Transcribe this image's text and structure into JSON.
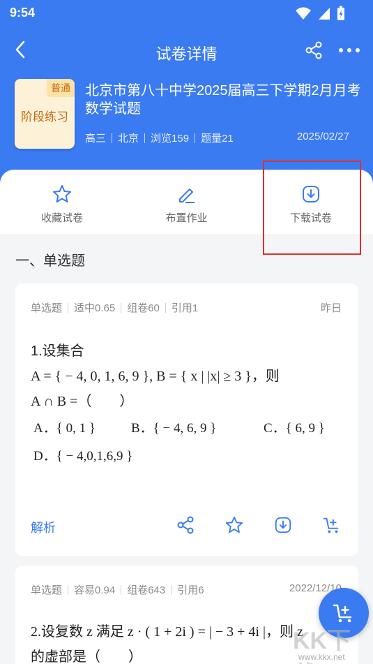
{
  "status": {
    "time": "9:54"
  },
  "nav": {
    "title": "试卷详情"
  },
  "paper": {
    "cover_badge": "普通",
    "cover_label": "阶段练习",
    "title": "北京市第八十中学2025届高三下学期2月月考数学试题",
    "meta": [
      "高三",
      "北京",
      "浏览159",
      "题量21"
    ],
    "date": "2025/02/27"
  },
  "actions": [
    {
      "label": "收藏试卷",
      "icon": "star-icon"
    },
    {
      "label": "布置作业",
      "icon": "pen-icon"
    },
    {
      "label": "下载试卷",
      "icon": "download-icon"
    }
  ],
  "section": {
    "title": "一、单选题"
  },
  "questions": [
    {
      "meta": [
        "单选题",
        "适中0.65",
        "组卷60",
        "引用1"
      ],
      "time": "昨日",
      "lines": [
        "1.设集合",
        "A = { − 4, 0, 1, 6, 9 }, B = { x | |x| ≥ 3 }，则",
        "A ∩ B =（　　）"
      ],
      "options": [
        "A．{ 0, 1 }",
        "B．{ − 4, 6, 9 }",
        "C．{ 6, 9 }",
        "D．{ − 4,0,1,6,9 }"
      ],
      "analysis_label": "解析"
    },
    {
      "meta": [
        "单选题",
        "容易0.94",
        "组卷643",
        "引用6"
      ],
      "time": "2022/12/10",
      "lines": [
        "2.设复数 z 满足 z · ( 1 + 2i ) = | − 3 + 4i |，则 z",
        "的虚部是（　　）"
      ]
    }
  ],
  "watermark": {
    "text": "KK下载",
    "url": "www.kkx.net"
  },
  "colors": {
    "primary": "#3a7bf2",
    "highlight": "#e52b2b"
  }
}
